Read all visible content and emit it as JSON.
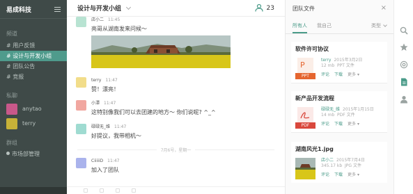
{
  "sidebar": {
    "team_name": "易成科技",
    "channels_section": "频道",
    "channels": [
      {
        "label": "# 用户反馈",
        "active": false
      },
      {
        "label": "# 设计与开发小组",
        "active": true
      },
      {
        "label": "# 团队公告",
        "active": false
      },
      {
        "label": "# 竞报",
        "active": false
      }
    ],
    "dm_section": "私聊",
    "dms": [
      {
        "name": "anytao",
        "color": "#c8588a"
      },
      {
        "name": "terry",
        "color": "#c7b138"
      }
    ],
    "groups_section": "群组",
    "groups": [
      {
        "label": "市场部管理"
      }
    ]
  },
  "chat": {
    "title": "设计与开发小组",
    "member_count": "23",
    "messages": [
      {
        "author": "店小二",
        "time": "11:45",
        "text": "亮哥从湖南发来问候～",
        "avatar_color": "#b8e3d2"
      },
      {
        "author": "terry",
        "time": "11:47",
        "text": "赞！漂亮！",
        "avatar_color": "#f2dd8a"
      },
      {
        "author": "小潭",
        "time": "11:47",
        "text": "这特别像我们可以去团建的地方～ 你们说呢? ^_^",
        "avatar_color": "#f1a7a0"
      },
      {
        "author": "碌碌无_维",
        "time": "11:47",
        "text": "好提议，我带相机～",
        "avatar_color": "#9fdbd1"
      },
      {
        "author": "CiiiiiD",
        "time": "11:47",
        "text": "加入了团队",
        "avatar_color": "#aab3ec"
      }
    ],
    "date_divider": "7月6号，星期一"
  },
  "files": {
    "title": "团队文件",
    "tabs": [
      "所有人",
      "我自己"
    ],
    "type_filter": "类型",
    "items": [
      {
        "name": "软件许可协议",
        "author": "terry",
        "date": "2015年3月2日",
        "size": "12 mb",
        "kind": "PPT 文件",
        "label": "PPT",
        "color": "#e5652f"
      },
      {
        "name": "新产品开发流程",
        "author": "碌碌无_维",
        "date": "2015年1月15日",
        "size": "14 mb",
        "kind": "PDF 文件",
        "label": "PDF",
        "color": "#d9473c"
      },
      {
        "name": "湖南风光1.jpg",
        "author": "店小二",
        "date": "2015年7月4日",
        "size": "345.17 kb",
        "kind": "JPG 文件",
        "label": "",
        "color": "#7a8a55"
      }
    ],
    "action_comment": "评论",
    "action_download": "下载",
    "action_more": "更多"
  },
  "iconbar": [
    "search-icon",
    "star-icon",
    "at-icon",
    "file-icon",
    "user-icon"
  ]
}
